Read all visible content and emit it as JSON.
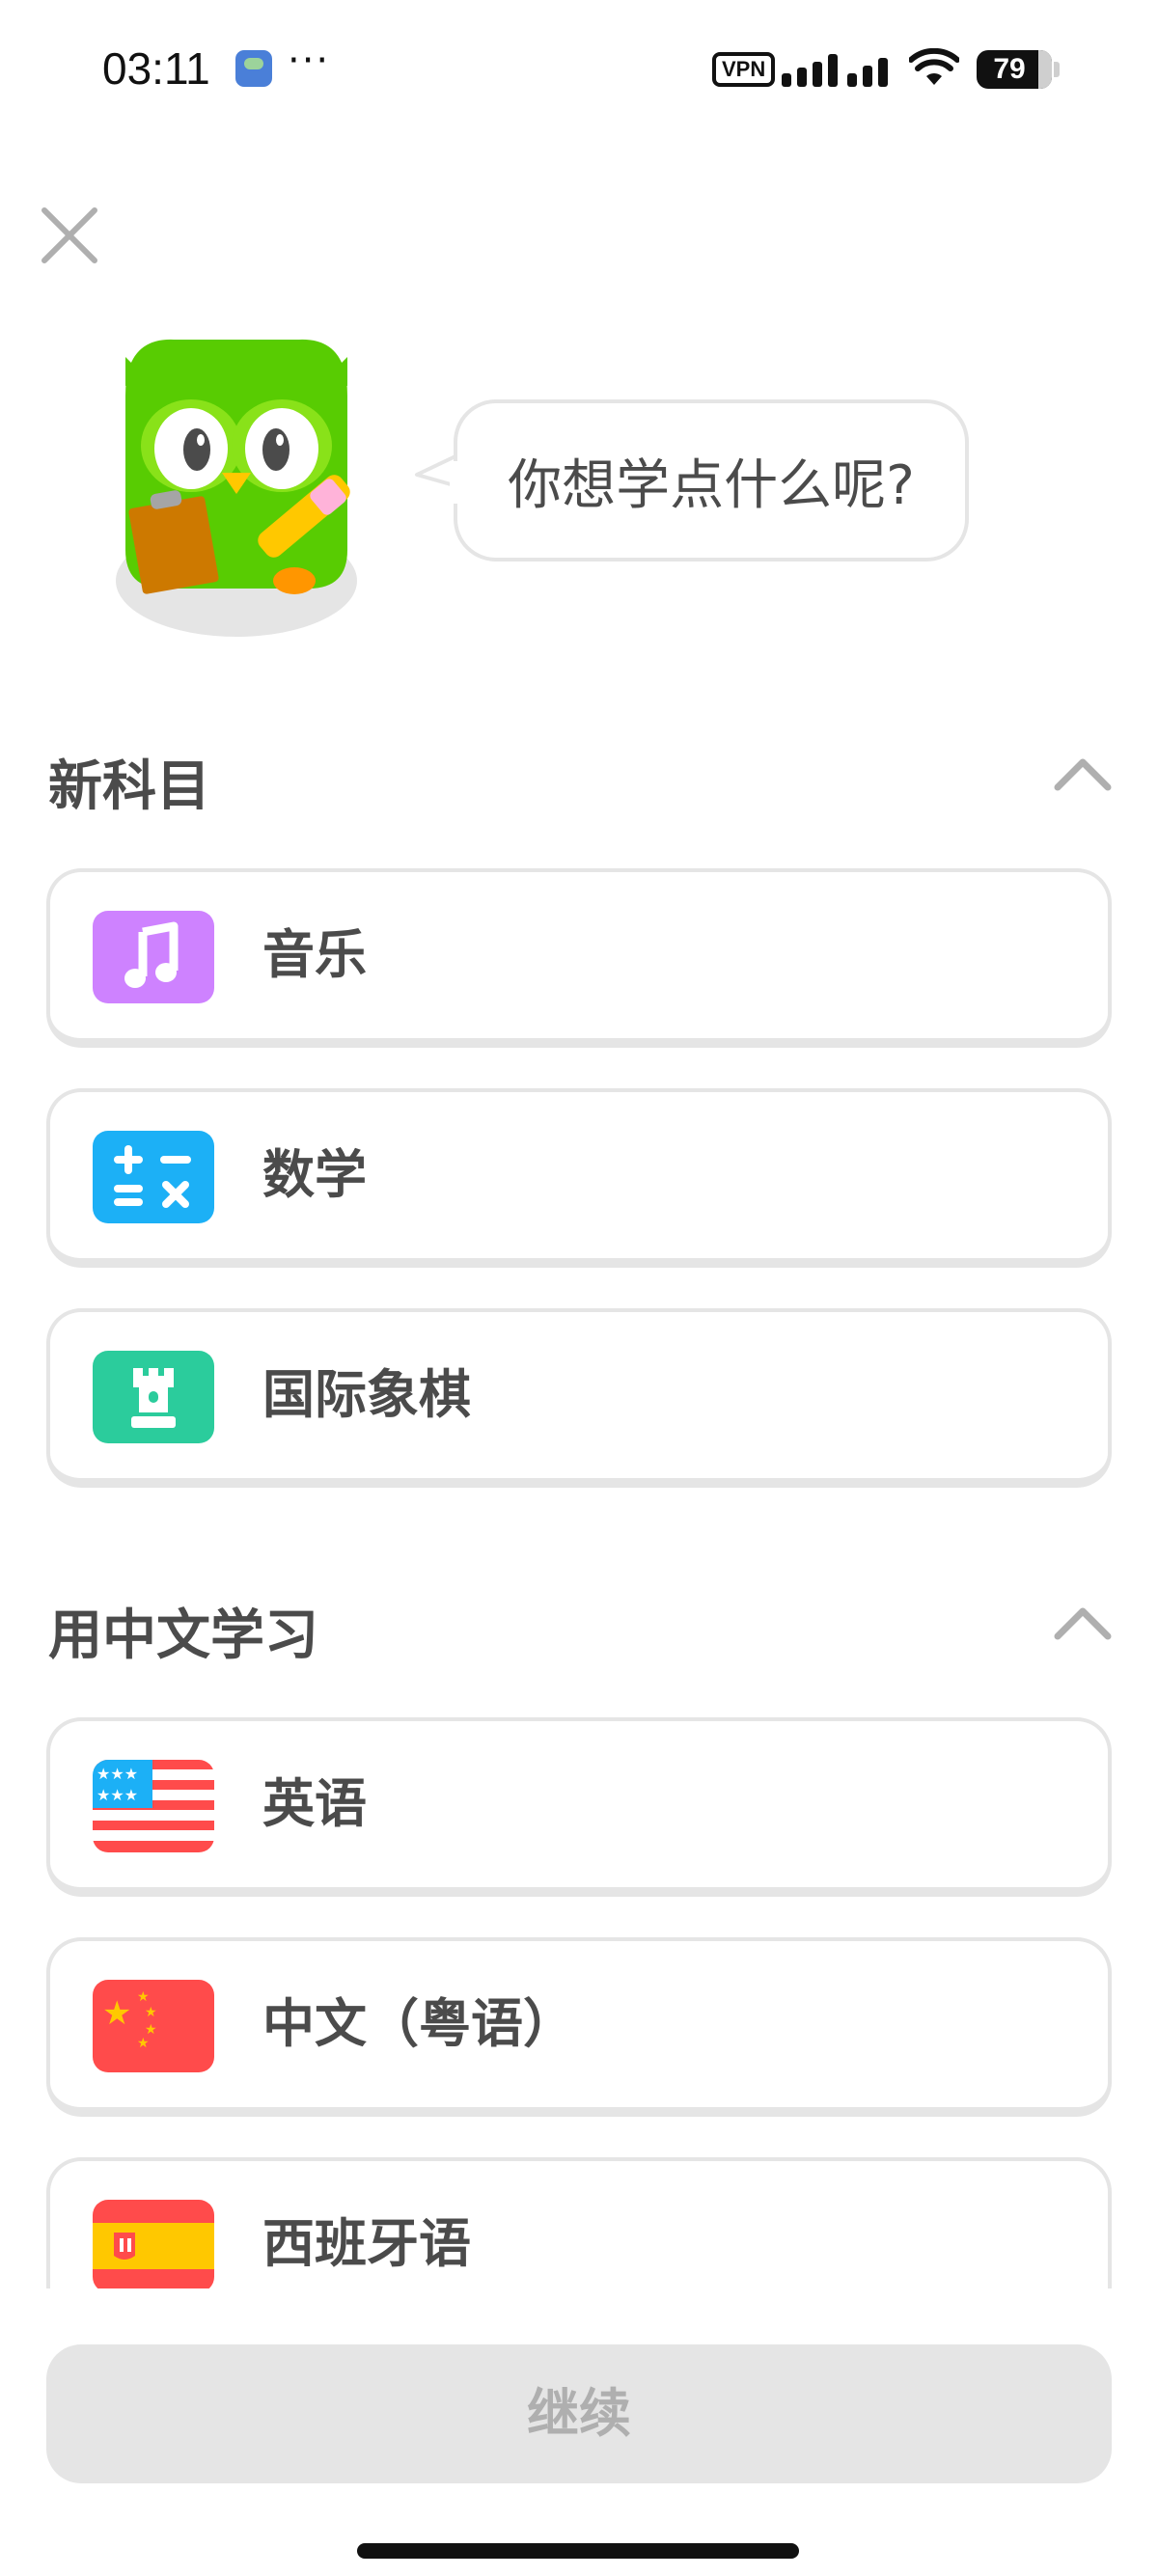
{
  "status_bar": {
    "time": "03:11",
    "more": "···",
    "vpn": "VPN",
    "battery": "79"
  },
  "bubble_text": "你想学点什么呢?",
  "sections": [
    {
      "title": "新科目",
      "items": [
        {
          "label": "音乐",
          "icon": "music-note-icon",
          "color": "#ce82ff"
        },
        {
          "label": "数学",
          "icon": "math-symbols-icon",
          "color": "#1cb0f6"
        },
        {
          "label": "国际象棋",
          "icon": "chess-rook-icon",
          "color": "#2bcc9c"
        }
      ]
    },
    {
      "title": "用中文学习",
      "items": [
        {
          "label": "英语",
          "icon": "us-flag-icon"
        },
        {
          "label": "中文（粤语）",
          "icon": "china-flag-icon"
        },
        {
          "label": "西班牙语",
          "icon": "spain-flag-icon"
        }
      ]
    }
  ],
  "continue_label": "继续",
  "colors": {
    "mascot_green": "#58cc02",
    "border": "#e5e5e5",
    "text": "#4b4b4b",
    "button_disabled": "#e5e5e5"
  }
}
